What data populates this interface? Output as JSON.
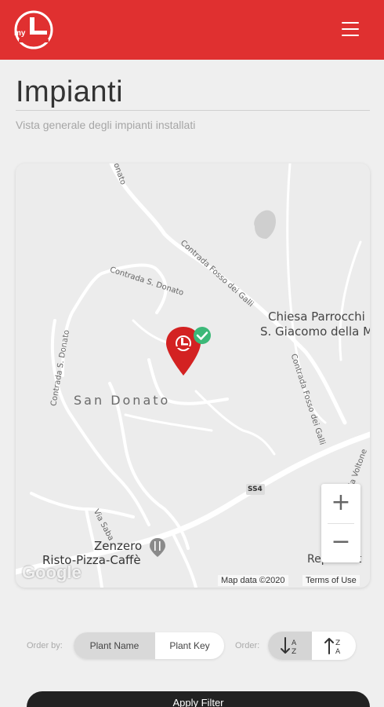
{
  "header": {
    "logo_text": "my",
    "menu_icon": "hamburger-menu-icon",
    "brand_color": "#e03030"
  },
  "page": {
    "title": "Impianti",
    "subtitle": "Vista generale degli impianti installati"
  },
  "map": {
    "labels": {
      "church_line1": "Chiesa Parrocchi",
      "church_line2": "S. Giacomo della M",
      "town": "San Donato",
      "restaurant_line1": "Zenzero",
      "restaurant_line2": "Risto-Pizza-Caffè",
      "right_cut": "Reper Aut",
      "road_ss4": "SS4"
    },
    "streets": {
      "contrada_s_donato_top": "Contrada S. Donato",
      "contrada_s_donato_left": "Contrada S. Donato",
      "contrada_fosso_galli_top": "Contrada Fosso dei Galli",
      "contrada_fosso_galli_right": "Contrada Fosso dei Galli",
      "via_saba": "Via Saba",
      "via_voltone": "Via Voltone",
      "nato_fragment": "onato"
    },
    "zoom_in": "+",
    "zoom_out": "−",
    "google": "Google",
    "map_data": "Map data ©2020",
    "terms": "Terms of Use",
    "marker_icon": "plant-location-pin-icon",
    "marker_status_icon": "check-badge-icon",
    "marker_color": "#d32222",
    "status_color": "#3cb878"
  },
  "filters": {
    "order_by_label": "Order by:",
    "plant_name": "Plant Name",
    "plant_key": "Plant Key",
    "order_label": "Order:",
    "sort_asc_icon": "sort-ascending-icon",
    "sort_desc_icon": "sort-descending-icon",
    "apply_label": "Apply Filter"
  }
}
